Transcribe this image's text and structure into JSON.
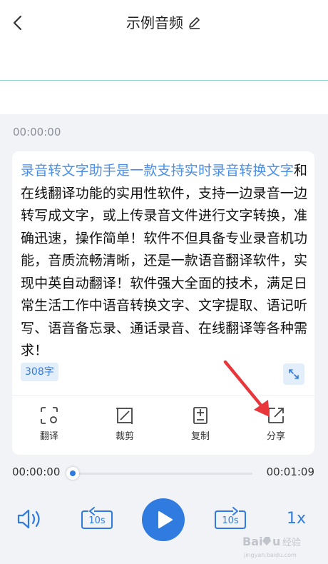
{
  "header": {
    "title": "示例音频",
    "back_icon": "chevron-left-icon",
    "edit_icon": "pencil-icon"
  },
  "segment": {
    "timestamp": "00:00:00",
    "text_highlighted": "录音转文字助手是一款支持实时录音转换文字",
    "text_rest": "和在线翻译功能的实用性软件，支持一边录音一边转写成文字，或上传录音文件进行文字转换，准确迅速，操作简单！软件不但具备专业录音机功能，音质流畅清晰，还是一款语音翻译软件，实现中英自动翻译！软件强大全面的技术，满足日常生活工作中语音转换文字、文字提取、语记听写、语音备忘录、通话录音、在线翻译等各种需求！",
    "word_count": "308字"
  },
  "actions": [
    {
      "label": "翻译",
      "icon": "translate-icon"
    },
    {
      "label": "裁剪",
      "icon": "crop-icon"
    },
    {
      "label": "复制",
      "icon": "copy-icon"
    },
    {
      "label": "分享",
      "icon": "share-icon"
    }
  ],
  "player": {
    "current_time": "00:00:00",
    "total_time": "00:01:09",
    "progress": 0,
    "rewind_label": "10s",
    "forward_label": "10s",
    "speed": "1x"
  },
  "watermark": {
    "text": "Baidu 经验"
  },
  "colors": {
    "accent": "#2f7be0",
    "highlight_text": "#4a8ee6",
    "annotation_arrow": "#e8363a"
  }
}
